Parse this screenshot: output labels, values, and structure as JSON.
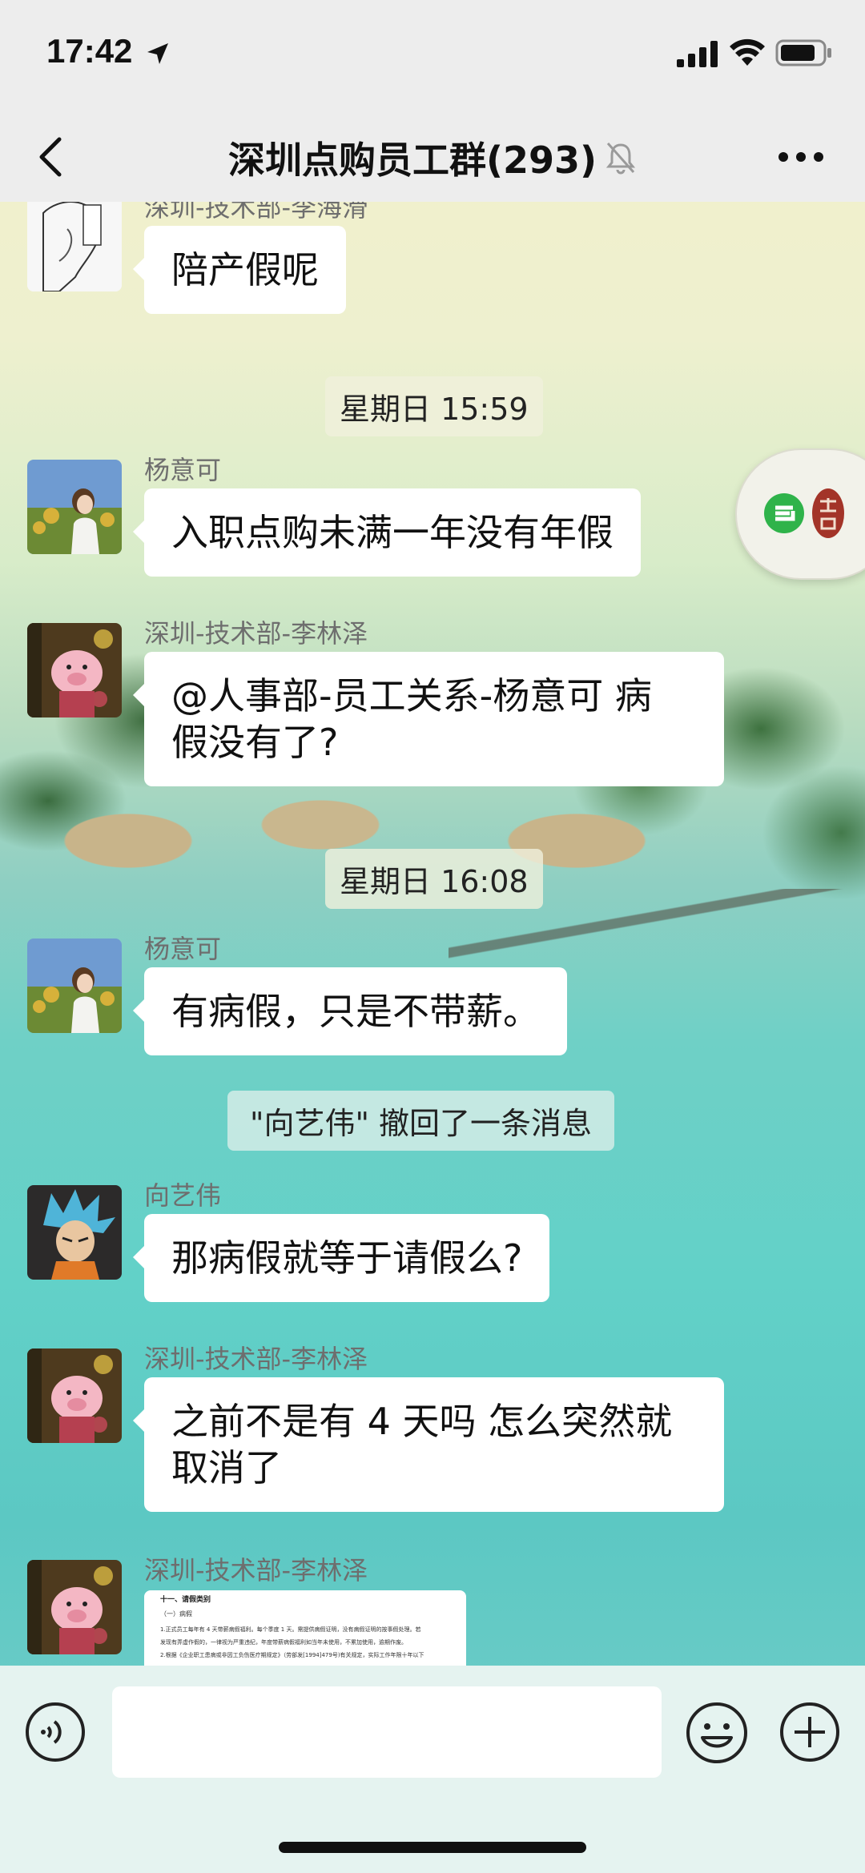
{
  "status": {
    "time": "17:42"
  },
  "nav": {
    "title": "深圳点购员工群(293)"
  },
  "messages": [
    {
      "sender": "深圳-技术部-李海滑",
      "text": "陪产假呢"
    },
    {
      "sender": "杨意可",
      "text": "入职点购未满一年没有年假"
    },
    {
      "sender": "深圳-技术部-李林泽",
      "text_line1": "@人事部-员工关系-杨意可 病",
      "text_line2": "假没有了?"
    },
    {
      "sender": "杨意可",
      "text": "有病假，只是不带薪。"
    },
    {
      "sender": "向艺伟",
      "text": "那病假就等于请假么?"
    },
    {
      "sender": "深圳-技术部-李林泽",
      "text_line1": "之前不是有 4 天吗 怎么突然就",
      "text_line2": "取消了"
    },
    {
      "sender": "深圳-技术部-李林泽"
    }
  ],
  "timestamps": [
    "星期日 15:59",
    "星期日 16:08"
  ],
  "system": {
    "recall_notice": "\"向艺伟\" 撤回了一条消息"
  },
  "doc_preview": {
    "heading": "十一、请假类别",
    "sub": "（一）病假",
    "line1": "1.正式员工每年有 4 天带薪病假福利。每个季度 1 天。需提供病假证明，没有病假证明的按事假处理。若",
    "line2": "发现有弄虚作假的，一律视为严重违纪，年度带薪病假福利如当年未使用，不累加使用，逾期作废。",
    "line3": "2.根据《企业职工患病或非因工负伤医疗期规定》（劳部发[1994]479号)有关规定，实际工作年限十年以下"
  },
  "input": {
    "placeholder": ""
  },
  "colors": {
    "bubble": "#ffffff",
    "header": "#ededed",
    "input_bar": "#e5f3f0"
  }
}
